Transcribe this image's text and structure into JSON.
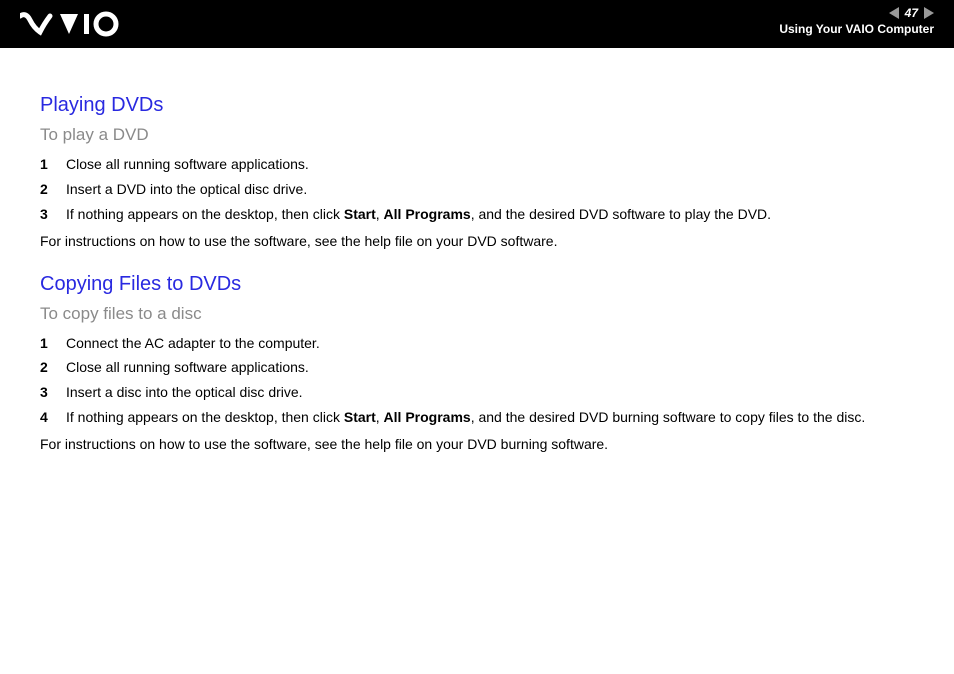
{
  "header": {
    "page_number": "47",
    "breadcrumb": "Using Your VAIO Computer"
  },
  "sections": [
    {
      "title": "Playing DVDs",
      "subtitle": "To play a DVD",
      "steps": [
        {
          "n": "1",
          "pre": "Close all running software applications."
        },
        {
          "n": "2",
          "pre": "Insert a DVD into the optical disc drive."
        },
        {
          "n": "3",
          "pre": "If nothing appears on the desktop, then click ",
          "b1": "Start",
          "mid": ", ",
          "b2": "All Programs",
          "post": ", and the desired DVD software to play the DVD."
        }
      ],
      "note": "For instructions on how to use the software, see the help file on your DVD software."
    },
    {
      "title": "Copying Files to DVDs",
      "subtitle": "To copy files to a disc",
      "steps": [
        {
          "n": "1",
          "pre": "Connect the AC adapter to the computer."
        },
        {
          "n": "2",
          "pre": "Close all running software applications."
        },
        {
          "n": "3",
          "pre": "Insert a disc into the optical disc drive."
        },
        {
          "n": "4",
          "pre": "If nothing appears on the desktop, then click ",
          "b1": "Start",
          "mid": ", ",
          "b2": "All Programs",
          "post": ", and the desired DVD burning software to copy files to the disc."
        }
      ],
      "note": "For instructions on how to use the software, see the help file on your DVD burning software."
    }
  ]
}
